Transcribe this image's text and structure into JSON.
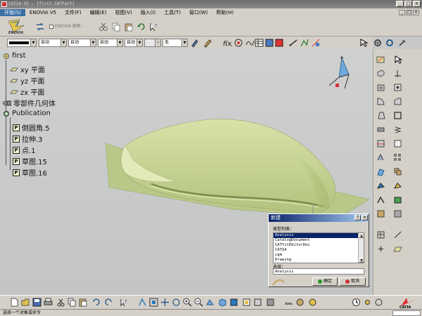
{
  "window": {
    "title": "CATIA V5 - [first.CATPart]",
    "controls": [
      "_",
      "□",
      "×"
    ]
  },
  "menu": {
    "items": [
      "开始(S)",
      "ENOVIA V5",
      "文件(F)",
      "编辑(E)",
      "视图(V)",
      "插入(I)",
      "工具(T)",
      "窗口(W)",
      "帮助(H)"
    ],
    "mdi_controls": [
      "_",
      "□",
      "×"
    ]
  },
  "toolbar": {
    "search_label": "ENOVIA 搜索...",
    "logo_text": "ENOVIA"
  },
  "properties": {
    "combos": [
      "",
      "自动",
      "自动",
      "自动",
      "自动",
      "",
      "无"
    ]
  },
  "tree": {
    "root": "first",
    "planes": [
      "xy 平面",
      "yz 平面",
      "zx 平面"
    ],
    "body": "零部件几何体",
    "publication": "Publication",
    "features": [
      "倒圆角.5",
      "拉伸.3",
      "点.1",
      "草图.15",
      "草图.16"
    ],
    "feature_icon_letter": "P"
  },
  "dialog": {
    "title": "新建",
    "title_buttons": [
      "?",
      "×"
    ],
    "list_label": "类型列表：",
    "types": [
      "Analysis",
      "CatalogDocument",
      "CATfctEditorDoc",
      "CATIA",
      "cgm",
      "Drawing"
    ],
    "selected_index": 0,
    "name_label": "选择：",
    "name_value": "Analysis",
    "ok_label": "确定",
    "cancel_label": "取消"
  },
  "status": {
    "text": "选择一个对象或命令"
  },
  "colors": {
    "part": "#c9d69a",
    "viewport": "#c8c9c9",
    "chrome": "#d4d0c8",
    "selection": "#0a246a"
  }
}
